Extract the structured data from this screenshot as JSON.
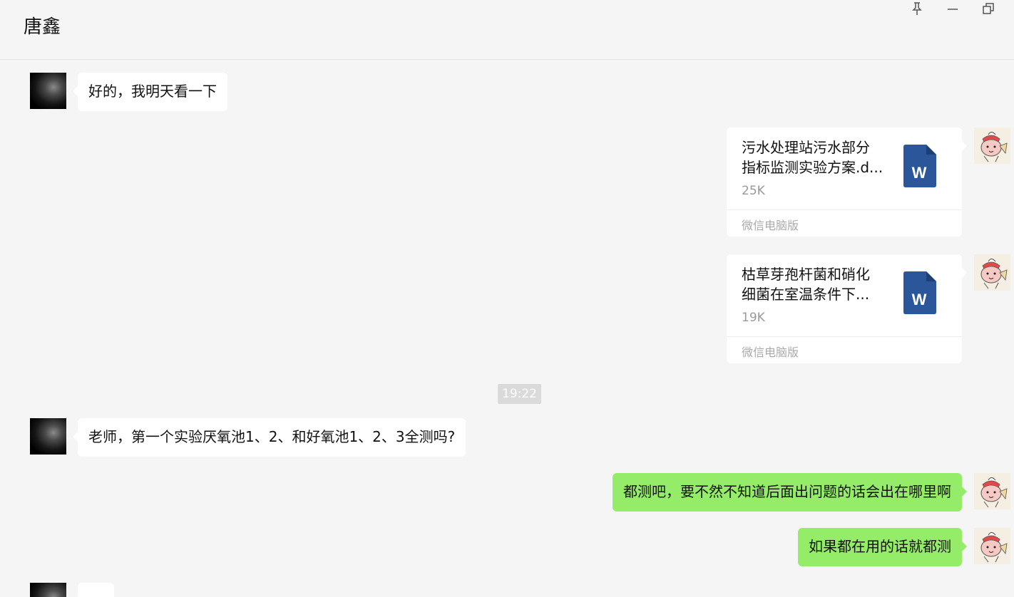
{
  "header": {
    "title": "唐鑫"
  },
  "messages": {
    "m1": {
      "text": "好的，我明天看一下"
    },
    "f1": {
      "line1": "污水处理站污水部分",
      "line2": "指标监测实验方案.d...",
      "size": "25K",
      "source": "微信电脑版",
      "file_icon_letter": "W"
    },
    "f2": {
      "line1": "枯草芽孢杆菌和硝化",
      "line2": "细菌在室温条件下...",
      "size": "19K",
      "source": "微信电脑版",
      "file_icon_letter": "W"
    },
    "time": "19:22",
    "m2": {
      "text": "老师，第一个实验厌氧池1、2、和好氧池1、2、3全测吗?"
    },
    "m3": {
      "text": "都测吧，要不然不知道后面出问题的话会出在哪里啊"
    },
    "m4": {
      "text": "如果都在用的话就都测"
    }
  },
  "icons": [
    "pin-icon",
    "minimize-icon",
    "restore-icon",
    "word-file-icon"
  ],
  "colors": {
    "outgoing_bubble": "#95ec69",
    "incoming_bubble": "#ffffff",
    "background": "#f5f5f5",
    "word_blue": "#2b579a"
  }
}
